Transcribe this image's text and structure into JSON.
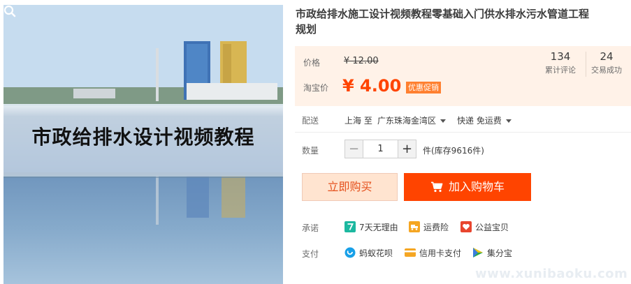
{
  "product": {
    "title_line1": "市政给排水施工设计视频教程零基础入门供水排水污水管道工程",
    "title_line2": "规划",
    "image_caption": "市政给排水设计视频教程"
  },
  "pricing": {
    "price_label": "价格",
    "original_price": "¥ 12.00",
    "taobao_price_label": "淘宝价",
    "promo_price": "¥ 4.00",
    "promo_badge": "优惠促销"
  },
  "stats": [
    {
      "value": "134",
      "label": "累计评论"
    },
    {
      "value": "24",
      "label": "交易成功"
    }
  ],
  "shipping": {
    "label": "配送",
    "from": "上海 至",
    "destination": "广东珠海金湾区",
    "method": "快递 免运费"
  },
  "quantity": {
    "label": "数量",
    "minus": "−",
    "value": "1",
    "plus": "+",
    "stock_text": "件(库存9616件)"
  },
  "actions": {
    "buy_now": "立即购买",
    "add_to_cart": "加入购物车"
  },
  "promise": {
    "label": "承诺",
    "items": [
      "7天无理由",
      "运费险",
      "公益宝贝"
    ]
  },
  "payment": {
    "label": "支付",
    "items": [
      "蚂蚁花呗",
      "信用卡支付",
      "集分宝"
    ]
  },
  "watermark": "www.xunibaoku.com",
  "colors": {
    "accent": "#ff4400",
    "price_bg": "#fff2e8",
    "badge": "#ff8030",
    "buy_bg": "#ffe4d0"
  }
}
